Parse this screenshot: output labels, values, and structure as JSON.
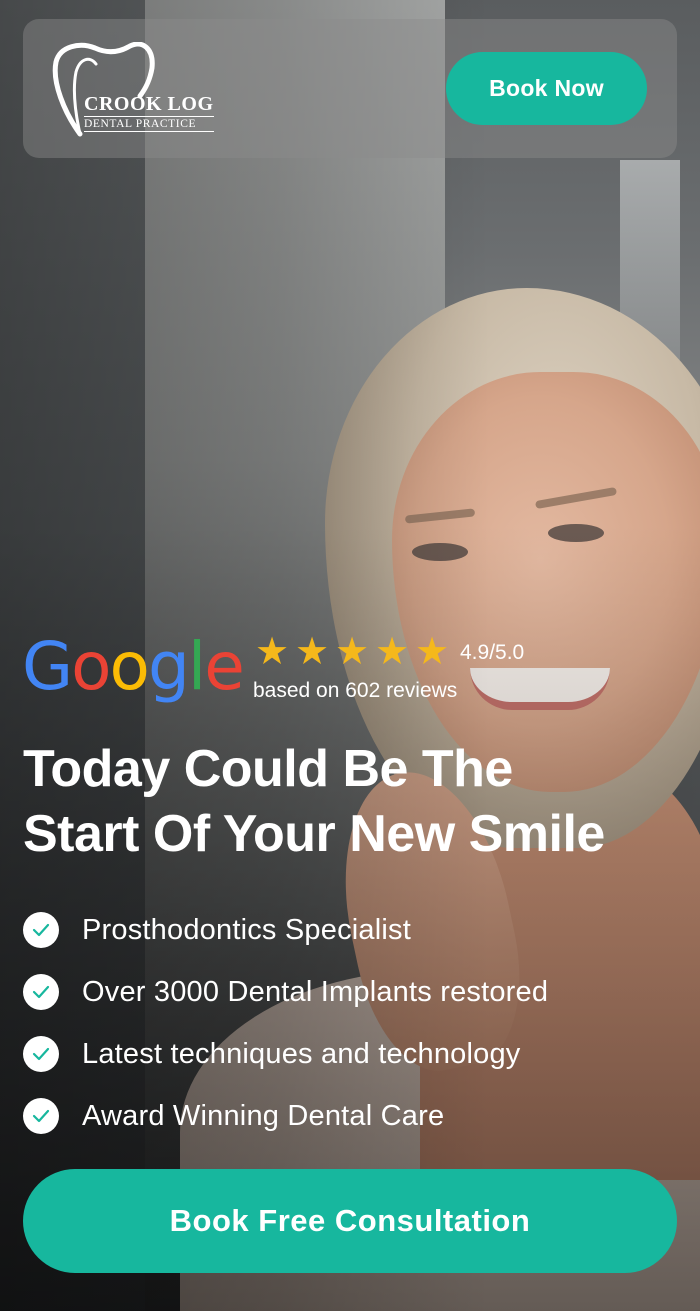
{
  "header": {
    "logo": {
      "line1": "CROOK LOG",
      "line2": "DENTAL PRACTICE",
      "icon": "tooth-icon"
    },
    "book_now_label": "Book Now"
  },
  "rating": {
    "brand": [
      "G",
      "o",
      "o",
      "g",
      "l",
      "e"
    ],
    "brand_colors": [
      "#4285F4",
      "#EA4335",
      "#FBBC05",
      "#4285F4",
      "#34A853",
      "#EA4335"
    ],
    "stars": 5,
    "star_color": "#F5B81B",
    "score": "4.9/5.0",
    "count_text": "based on 602 reviews"
  },
  "headline": {
    "light": "Today Could Be ",
    "bold_a": "The",
    "bold_b": "Start Of Your New Smile"
  },
  "features": [
    {
      "text": "Prosthodontics Specialist",
      "icon": "check-icon"
    },
    {
      "text": "Over 3000 Dental Implants restored",
      "icon": "check-icon"
    },
    {
      "text": "Latest techniques and technology",
      "icon": "check-icon"
    },
    {
      "text": "Award Winning Dental Care",
      "icon": "check-icon"
    }
  ],
  "cta": {
    "label": "Book Free Consultation"
  },
  "colors": {
    "accent": "#17B79E",
    "text": "#FFFFFF"
  }
}
